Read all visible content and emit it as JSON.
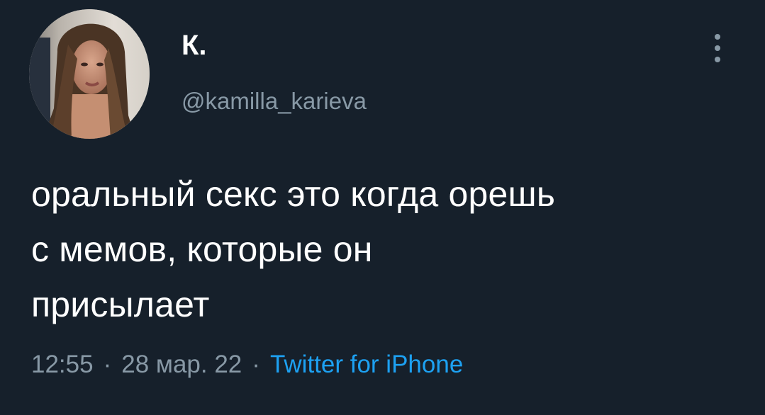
{
  "tweet": {
    "author": {
      "display_name": "К.",
      "handle": "@kamilla_karieva",
      "avatar": "profile-photo"
    },
    "text_lines": [
      "оральный секс это когда орешь",
      "с мемов, которые он",
      "присылает"
    ],
    "time": "12:55",
    "date": "28 мар. 22",
    "separator": "·",
    "source": "Twitter for iPhone",
    "more_icon": "more-vertical-icon"
  },
  "colors": {
    "background": "#16202b",
    "text": "#ffffff",
    "secondary": "#8899a6",
    "link": "#1da1f2"
  }
}
